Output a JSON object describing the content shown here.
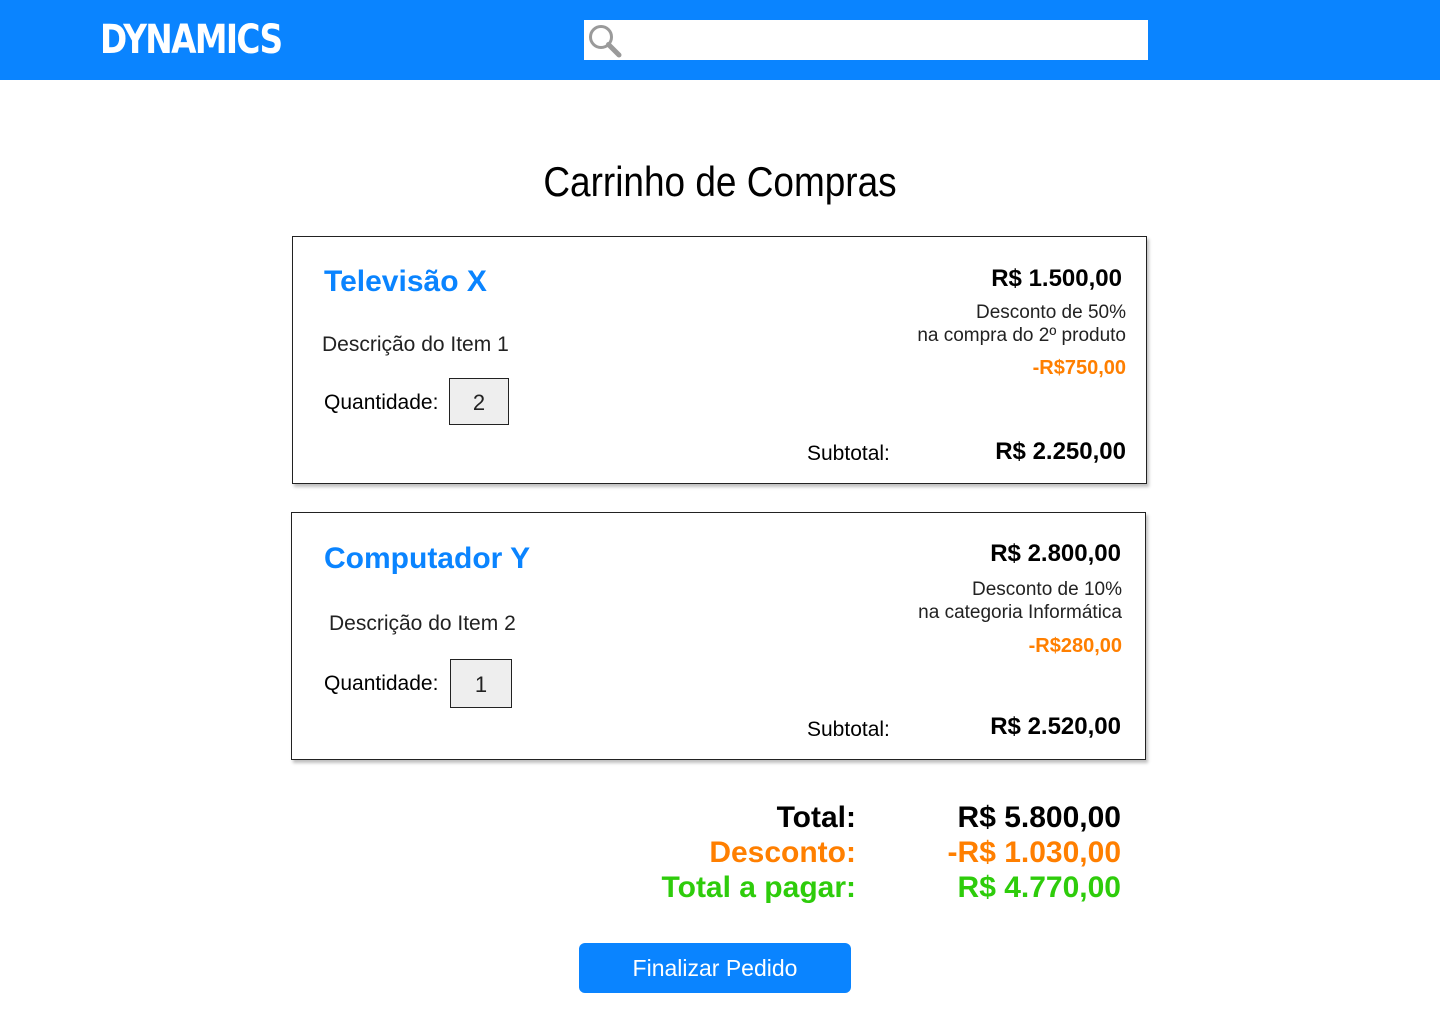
{
  "header": {
    "logo": "DYNAMICS",
    "search_placeholder": "",
    "brand_color": "#0A84FF"
  },
  "page": {
    "title": "Carrinho de Compras"
  },
  "items": [
    {
      "name": "Televisão X",
      "description": "Descrição do Item 1",
      "quantity_label": "Quantidade:",
      "quantity": "2",
      "price": "R$ 1.500,00",
      "discount_line1": "Desconto de 50%",
      "discount_line2": "na compra do 2º produto",
      "discount_amount": "-R$750,00",
      "subtotal_label": "Subtotal:",
      "subtotal": "R$ 2.250,00"
    },
    {
      "name": "Computador Y",
      "description": "Descrição do Item 2",
      "quantity_label": "Quantidade:",
      "quantity": "1",
      "price": "R$ 2.800,00",
      "discount_line1": "Desconto de 10%",
      "discount_line2": "na categoria Informática",
      "discount_amount": "-R$280,00",
      "subtotal_label": "Subtotal:",
      "subtotal": "R$ 2.520,00"
    }
  ],
  "summary": {
    "total_label": "Total:",
    "total_value": "R$ 5.800,00",
    "discount_label": "Desconto:",
    "discount_value": "-R$ 1.030,00",
    "pay_label": "Total a pagar:",
    "pay_value": "R$ 4.770,00",
    "colors": {
      "discount": "#FF7F00",
      "pay": "#2ECC0B"
    }
  },
  "actions": {
    "finalize_label": "Finalizar Pedido"
  }
}
